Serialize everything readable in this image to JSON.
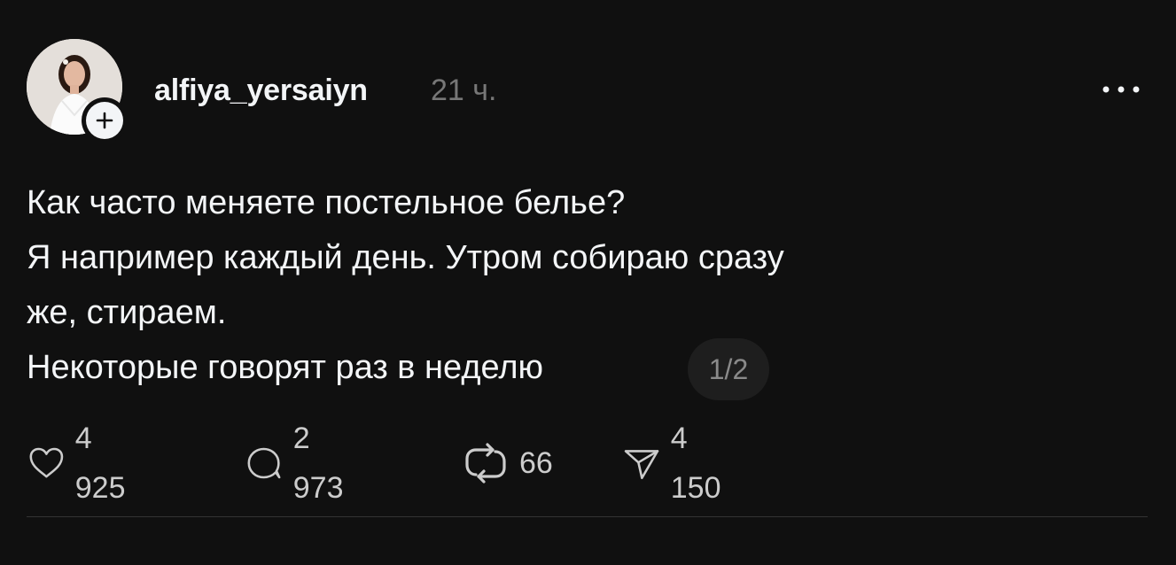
{
  "post": {
    "author": {
      "username": "alfiya_yersaiyn",
      "avatar_icon": "profile-photo",
      "follow_icon": "plus-icon"
    },
    "timestamp": "21 ч.",
    "more_icon": "ellipsis-icon",
    "text_lines": [
      "Как часто меняете постельное белье?",
      "Я например каждый день. Утром собираю сразу",
      "же, стираем.",
      "Некоторые говорят раз в неделю"
    ],
    "pager": "1/2",
    "actions": {
      "like": {
        "icon": "heart-icon",
        "count": "4 925"
      },
      "comment": {
        "icon": "comment-icon",
        "count": "2 973"
      },
      "repost": {
        "icon": "repost-icon",
        "count": "66"
      },
      "share": {
        "icon": "send-icon",
        "count": "4 150"
      }
    }
  },
  "colors": {
    "background": "#101010",
    "primary_text": "#f3f5f7",
    "secondary_text": "#777777",
    "pager_bg": "#1e1e1e"
  }
}
